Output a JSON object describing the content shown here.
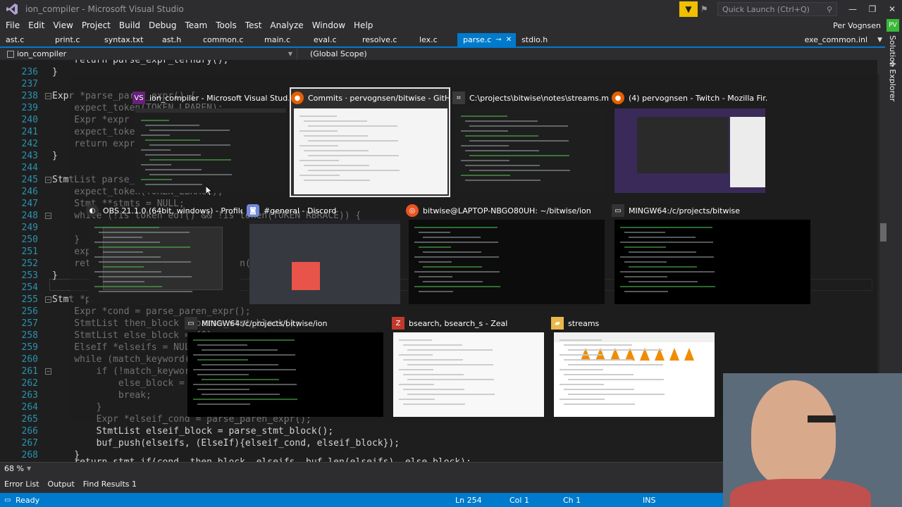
{
  "window": {
    "title": "ion_compiler - Microsoft Visual Studio",
    "quick_launch_placeholder": "Quick Launch (Ctrl+Q)",
    "user_name": "Per Vognsen",
    "user_initials": "PV"
  },
  "menu": [
    "File",
    "Edit",
    "View",
    "Project",
    "Build",
    "Debug",
    "Team",
    "Tools",
    "Test",
    "Analyze",
    "Window",
    "Help"
  ],
  "tabs": [
    {
      "label": "ast.c"
    },
    {
      "label": "print.c"
    },
    {
      "label": "syntax.txt"
    },
    {
      "label": "ast.h"
    },
    {
      "label": "common.c"
    },
    {
      "label": "main.c"
    },
    {
      "label": "eval.c"
    },
    {
      "label": "resolve.c"
    },
    {
      "label": "lex.c"
    },
    {
      "label": "parse.c",
      "active": true
    },
    {
      "label": "stdio.h"
    }
  ],
  "right_tab": "exe_common.inl",
  "scope": {
    "project": "ion_compiler",
    "global": "(Global Scope)"
  },
  "side_panel": "Solution Explorer",
  "code": {
    "line_numbers": [
      "236",
      "237",
      "238",
      "239",
      "240",
      "241",
      "242",
      "243",
      "244",
      "245",
      "246",
      "247",
      "248",
      "249",
      "250",
      "251",
      "252",
      "253",
      "254",
      "255",
      "256",
      "257",
      "258",
      "259",
      "260",
      "261",
      "262",
      "263",
      "264",
      "265",
      "266",
      "267",
      "268"
    ],
    "lines": [
      "}",
      "",
      "Expr *parse_paren_expr() {",
      "    expect_token(TOKEN_LPAREN);",
      "    Expr *expr = parse_expr();",
      "    expect_token(TOKEN_RPAREN);",
      "    return expr;",
      "}",
      "",
      "StmtList parse_stmt_block() {",
      "    expect_token(TOKEN_LBRACE);",
      "    Stmt **stmts = NULL;",
      "    while (!is_token_eof() && !is_token(TOKEN_RBRACE)) {",
      "",
      "    }",
      "    expect_token(TOKEN_RBRACE);",
      "    return stmt_list(stmts, buf_len(stmts));",
      "}",
      "",
      "Stmt *parse_stmt_if() {",
      "    Expr *cond = parse_paren_expr();",
      "    StmtList then_block = parse_stmt_block();",
      "    StmtList else_block = {0};",
      "    ElseIf *elseifs = NULL;",
      "    while (match_keyword(else_keyword)) {",
      "        if (!match_keyword(if_keyword)) {",
      "            else_block = parse_stmt_block();",
      "            break;",
      "        }",
      "        Expr *elseif_cond = parse_paren_expr();",
      "        StmtList elseif_block = parse_stmt_block();",
      "        buf_push(elseifs, (ElseIf){elseif_cond, elseif_block});",
      "    }"
    ],
    "top_partial": "    return parse_expr_ternary();",
    "bottom_partial": "    return stmt_if(cond, then_block, elseifs, buf_len(elseifs), else_block);"
  },
  "zoom": "68 %",
  "bottom_tabs": [
    "Error List",
    "Output",
    "Find Results 1"
  ],
  "status": {
    "ready": "Ready",
    "ln": "Ln 254",
    "col": "Col 1",
    "ch": "Ch 1",
    "ins": "INS"
  },
  "switcher": [
    {
      "title": "ion_compiler - Microsoft Visual Stud...",
      "icon": "visual-studio-icon"
    },
    {
      "title": "Commits · pervognsen/bitwise - GitH...",
      "icon": "firefox-icon",
      "selected": true
    },
    {
      "title": "C:\\projects\\bitwise\\notes\\streams.m...",
      "icon": "visual-studio-code-icon"
    },
    {
      "title": "(4) pervognsen - Twitch - Mozilla Fir...",
      "icon": "firefox-icon"
    },
    {
      "title": "OBS 21.1.0 (64bit, windows) - Profile:...",
      "icon": "obs-icon"
    },
    {
      "title": "#general - Discord",
      "icon": "discord-icon"
    },
    {
      "title": "bitwise@LAPTOP-NBGO80UH: ~/bitwise/ion",
      "icon": "ubuntu-icon"
    },
    {
      "title": "MINGW64:/c/projects/bitwise",
      "icon": "terminal-icon"
    },
    {
      "title": "MINGW64:/c/projects/bitwise/ion",
      "icon": "terminal-icon"
    },
    {
      "title": "bsearch, bsearch_s - Zeal",
      "icon": "zeal-icon"
    },
    {
      "title": "streams",
      "icon": "folder-icon"
    }
  ],
  "colors": {
    "accent": "#007acc",
    "background": "#1e1e1e",
    "chrome": "#2d2d30",
    "line_number": "#2b91af"
  }
}
